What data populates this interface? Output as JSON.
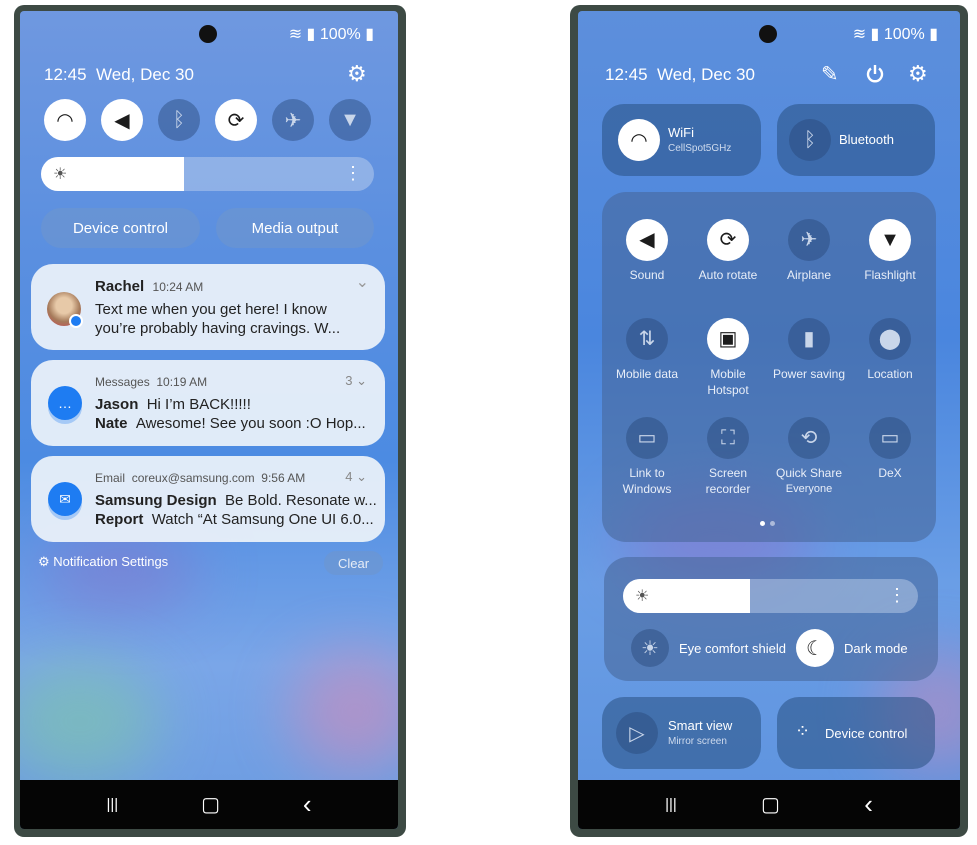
{
  "left": {
    "status": {
      "battery": "100%"
    },
    "time": "12:45",
    "date": "Wed, Dec 30",
    "quick_toggles": [
      {
        "icon": "wifi-icon",
        "on": true
      },
      {
        "icon": "sound-icon",
        "on": true
      },
      {
        "icon": "bluetooth-icon",
        "on": false
      },
      {
        "icon": "auto-rotate-icon",
        "on": true
      },
      {
        "icon": "airplane-icon",
        "on": false
      },
      {
        "icon": "flashlight-icon",
        "on": false
      }
    ],
    "brightness": 0.43,
    "buttons": {
      "device_control": "Device control",
      "media_output": "Media output"
    },
    "notifications": [
      {
        "sender": "Rachel",
        "time": "10:24 AM",
        "text": "Text me when you get here! I know you’re probably having cravings. W..."
      },
      {
        "app": "Messages",
        "time": "10:19 AM",
        "count": "3",
        "lines": [
          {
            "name": "Jason",
            "text": "Hi I’m BACK!!!!!"
          },
          {
            "name": "Nate",
            "text": "Awesome! See you soon :O Hop..."
          }
        ]
      },
      {
        "app": "Email",
        "account": "coreux@samsung.com",
        "time": "9:56 AM",
        "count": "4",
        "lines": [
          {
            "name": "Samsung Design",
            "text": "Be Bold. Resonate w..."
          },
          {
            "name": "Report",
            "text": "Watch “At Samsung One UI 6.0..."
          }
        ]
      }
    ],
    "notification_settings": "Notification Settings",
    "clear": "Clear"
  },
  "right": {
    "status": {
      "battery": "100%"
    },
    "time": "12:45",
    "date": "Wed, Dec 30",
    "wifi": {
      "label": "WiFi",
      "network": "CellSpot5GHz"
    },
    "bluetooth": {
      "label": "Bluetooth"
    },
    "grid": [
      {
        "label": "Sound",
        "icon": "sound-icon",
        "on": true
      },
      {
        "label": "Auto rotate",
        "icon": "auto-rotate-icon",
        "on": true
      },
      {
        "label": "Airplane",
        "icon": "airplane-icon",
        "on": false
      },
      {
        "label": "Flashlight",
        "icon": "flashlight-icon",
        "on": true
      },
      {
        "label": "Mobile data",
        "icon": "mobile-data-icon",
        "on": false
      },
      {
        "label": "Mobile Hotspot",
        "icon": "hotspot-icon",
        "on": true
      },
      {
        "label": "Power saving",
        "icon": "power-saving-icon",
        "on": false
      },
      {
        "label": "Location",
        "icon": "location-icon",
        "on": false
      },
      {
        "label": "Link to Windows",
        "icon": "link-to-windows-icon",
        "on": false
      },
      {
        "label": "Screen recorder",
        "icon": "screen-recorder-icon",
        "on": false
      },
      {
        "label": "Quick Share",
        "sub": "Everyone",
        "icon": "quick-share-icon",
        "on": false
      },
      {
        "label": "DeX",
        "icon": "dex-icon",
        "on": false
      }
    ],
    "page_indicator": {
      "pages": 2,
      "current": 1
    },
    "brightness": 0.43,
    "eye_comfort": "Eye comfort shield",
    "dark_mode": "Dark mode",
    "smart_view": {
      "label": "Smart view",
      "sub": "Mirror screen"
    },
    "device_control": "Device control"
  },
  "glyphs": {
    "wifi": "◠",
    "sound": "◀)",
    "bluetooth": "ᛒ",
    "rotate": "⟳",
    "airplane": "✈",
    "flashlight": "▼",
    "gear": "⚙",
    "pencil": "✎",
    "power": "⏻",
    "sun": "☀",
    "more": "⋮",
    "chev": "⌄",
    "recent": "|||",
    "home": "▢",
    "back": "‹",
    "moon": "☾",
    "msg": "…",
    "mail": "✉"
  }
}
